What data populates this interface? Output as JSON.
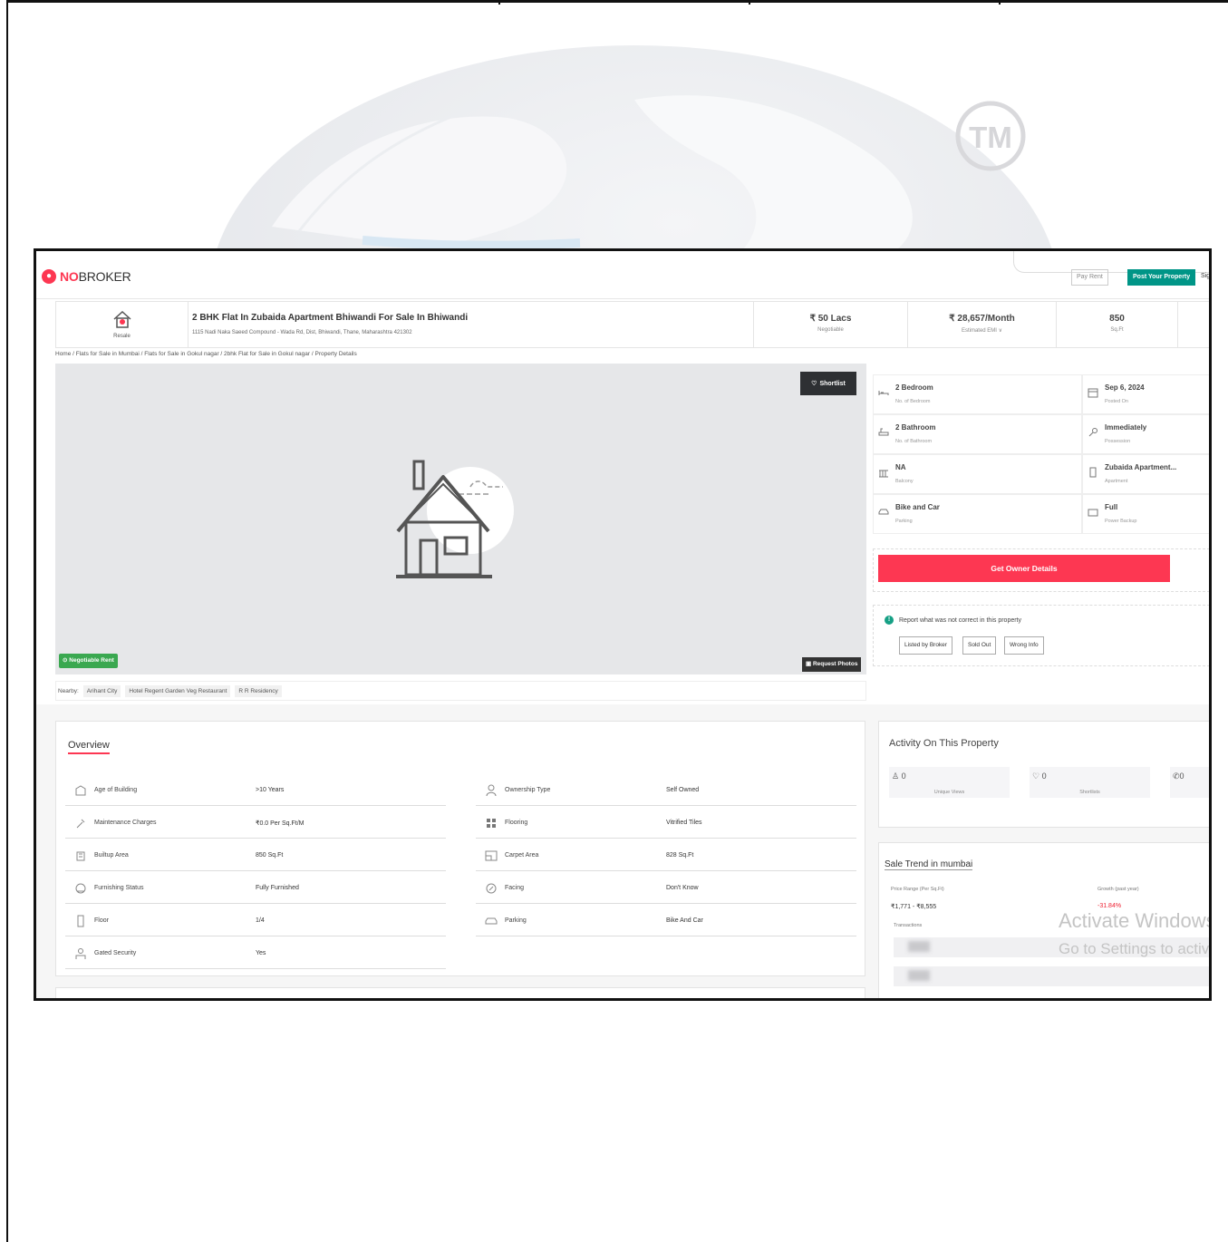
{
  "watermark": {
    "tm": "TM"
  },
  "header": {
    "logo_no": "NO",
    "logo_broker": "BROKER",
    "pay_rent": "Pay Rent",
    "post_property": "Post Your Property",
    "sign_cut": "Sig"
  },
  "listing": {
    "type_label": "Resale",
    "title": "2 BHK Flat In Zubaida Apartment Bhiwandi For Sale In Bhiwandi",
    "address": "1115 Nadi Naka Saeed Compound - Wada Rd, Dist, Bhiwandi, Thane, Maharashtra 421302",
    "price": "₹ 50 Lacs",
    "price_sub": "Negotiable",
    "emi": "₹ 28,657/Month",
    "emi_sub": "Estimated EMI ∨",
    "area": "850",
    "area_sub": "Sq.Ft"
  },
  "breadcrumb": "Home / Flats for Sale in Mumbai / Flats for Sale in Gokul nagar / 2bhk Flat for Sale in Gokul nagar / Property Details",
  "photo": {
    "shortlist": "Shortlist",
    "negotiable_badge": "Negotiable Rent",
    "request_photos": "Request Photos"
  },
  "nearby": {
    "label": "Nearby:",
    "places": [
      "Arihant City",
      "Hotel Regent Garden Veg Restaurant",
      "R R Residency"
    ]
  },
  "facts": [
    {
      "value": "2 Bedroom",
      "sub": "No. of Bedroom",
      "icon": "bed-icon"
    },
    {
      "value": "Sep 6, 2024",
      "sub": "Posted On",
      "icon": "calendar-icon"
    },
    {
      "value": "2 Bathroom",
      "sub": "No. of Bathroom",
      "icon": "bath-icon"
    },
    {
      "value": "Immediately",
      "sub": "Possession",
      "icon": "key-icon"
    },
    {
      "value": "NA",
      "sub": "Balcony",
      "icon": "balcony-icon"
    },
    {
      "value": "Zubaida Apartment...",
      "sub": "Apartment",
      "icon": "building-icon"
    },
    {
      "value": "Bike and Car",
      "sub": "Parking",
      "icon": "car-icon"
    },
    {
      "value": "Full",
      "sub": "Power Backup",
      "icon": "battery-icon"
    }
  ],
  "owner": {
    "button": "Get Owner Details"
  },
  "report": {
    "text": "Report what was not correct in this property",
    "buttons": [
      "Listed by Broker",
      "Sold Out",
      "Wrong Info"
    ]
  },
  "overview": {
    "title": "Overview",
    "left": [
      {
        "key": "Age of Building",
        "value": ">10 Years",
        "icon": "building-age-icon"
      },
      {
        "key": "Maintenance Charges",
        "value": "₹0.0 Per Sq.Ft/M",
        "icon": "tools-icon"
      },
      {
        "key": "Builtup Area",
        "value": "850 Sq.Ft",
        "icon": "area-building-icon"
      },
      {
        "key": "Furnishing Status",
        "value": "Fully Furnished",
        "icon": "sofa-icon"
      },
      {
        "key": "Floor",
        "value": "1/4",
        "icon": "floor-icon"
      },
      {
        "key": "Gated Security",
        "value": "Yes",
        "icon": "guard-icon"
      }
    ],
    "right": [
      {
        "key": "Ownership Type",
        "value": "Self Owned",
        "icon": "owner-icon"
      },
      {
        "key": "Flooring",
        "value": "Vitrified Tiles",
        "icon": "tiles-icon"
      },
      {
        "key": "Carpet Area",
        "value": "828 Sq.Ft",
        "icon": "carpet-icon"
      },
      {
        "key": "Facing",
        "value": "Don't Know",
        "icon": "compass-icon"
      },
      {
        "key": "Parking",
        "value": "Bike And Car",
        "icon": "car-icon"
      }
    ]
  },
  "activity": {
    "title": "Activity On This Property",
    "cards": [
      {
        "value": "0",
        "label": "Unique Views",
        "icon": "user-icon"
      },
      {
        "value": "0",
        "label": "Shortlists",
        "icon": "heart-icon"
      },
      {
        "value": "0",
        "label": "",
        "icon": "phone-icon"
      }
    ]
  },
  "trend": {
    "title": "Sale Trend in mumbai",
    "price_range_label": "Price Range (Per Sq.Ft)",
    "price_range": "₹1,771 - ₹8,555",
    "growth_label": "Growth (past year)",
    "growth": "-31.84%",
    "transactions": "Transactions",
    "rows": [
      "",
      ""
    ]
  },
  "windows": {
    "line1": "Activate Windows",
    "line2": "Go to Settings to activate"
  }
}
